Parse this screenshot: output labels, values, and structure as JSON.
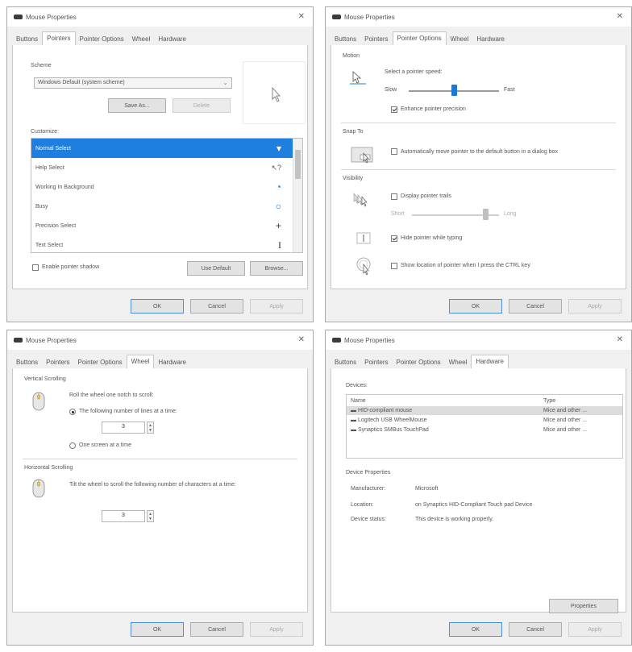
{
  "window_title": "Mouse Properties",
  "tabs": [
    "Buttons",
    "Pointers",
    "Pointer Options",
    "Wheel",
    "Hardware"
  ],
  "buttons": {
    "ok": "OK",
    "cancel": "Cancel",
    "apply": "Apply"
  },
  "pointers": {
    "scheme_label": "Scheme",
    "scheme_value": "Windows Default (system scheme)",
    "save_as": "Save As...",
    "delete": "Delete",
    "customize_label": "Customize:",
    "items": [
      {
        "label": "Normal Select",
        "icon": "arrow-cursor-icon"
      },
      {
        "label": "Help Select",
        "icon": "help-cursor-icon"
      },
      {
        "label": "Working In Background",
        "icon": "working-cursor-icon"
      },
      {
        "label": "Busy",
        "icon": "busy-cursor-icon"
      },
      {
        "label": "Precision Select",
        "icon": "crosshair-cursor-icon"
      },
      {
        "label": "Text Select",
        "icon": "text-cursor-icon"
      }
    ],
    "enable_shadow": "Enable pointer shadow",
    "use_default": "Use Default",
    "browse": "Browse..."
  },
  "pointer_options": {
    "motion_label": "Motion",
    "select_speed": "Select a pointer speed:",
    "slow": "Slow",
    "fast": "Fast",
    "speed_level": 0.5,
    "enhance_precision": "Enhance pointer precision",
    "snap_to_label": "Snap To",
    "snap_to_text": "Automatically move pointer to the default button in a dialog box",
    "visibility_label": "Visibility",
    "display_trails": "Display pointer trails",
    "short": "Short",
    "long": "Long",
    "trail_level": 0.85,
    "hide_typing": "Hide pointer while typing",
    "show_location": "Show location of pointer when I press the CTRL key"
  },
  "wheel": {
    "vertical_label": "Vertical Scrolling",
    "roll_text": "Roll the wheel one notch to scroll:",
    "lines_option": "The following number of lines at a time:",
    "lines_value": "3",
    "screen_option": "One screen at a time",
    "horizontal_label": "Horizontal Scrolling",
    "tilt_text": "Tilt the wheel to scroll the following number of characters at a time:",
    "chars_value": "3"
  },
  "hardware": {
    "devices_label": "Devices:",
    "col_name": "Name",
    "col_type": "Type",
    "devices": [
      {
        "name": "HID-compliant mouse",
        "type": "Mice and other ..."
      },
      {
        "name": "Logitech USB WheelMouse",
        "type": "Mice and other ..."
      },
      {
        "name": "Synaptics SMBus TouchPad",
        "type": "Mice and other ..."
      }
    ],
    "device_props_label": "Device Properties",
    "manufacturer_label": "Manufacturer:",
    "manufacturer_value": "Microsoft",
    "location_label": "Location:",
    "location_value": "on Synaptics HID-Compliant Touch pad Device",
    "status_label": "Device status:",
    "status_value": "This device is working properly.",
    "properties": "Properties"
  }
}
